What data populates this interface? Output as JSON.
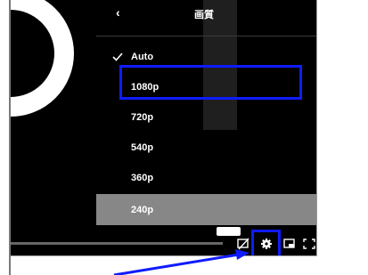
{
  "settings_panel": {
    "title": "画質",
    "back_icon": "chevron-left-icon",
    "options": [
      {
        "label": "Auto",
        "selected_check": true
      },
      {
        "label": "1080p"
      },
      {
        "label": "720p"
      },
      {
        "label": "540p"
      },
      {
        "label": "360p"
      },
      {
        "label": "240p",
        "hovered": true
      }
    ]
  },
  "controls": {
    "icons": [
      "captions-icon",
      "gear-icon",
      "picture-in-picture-icon",
      "fullscreen-icon"
    ]
  },
  "colors": {
    "panel_bg": "#000000",
    "hover_row": "#878787",
    "annotation_blue": "#0f1cff"
  }
}
